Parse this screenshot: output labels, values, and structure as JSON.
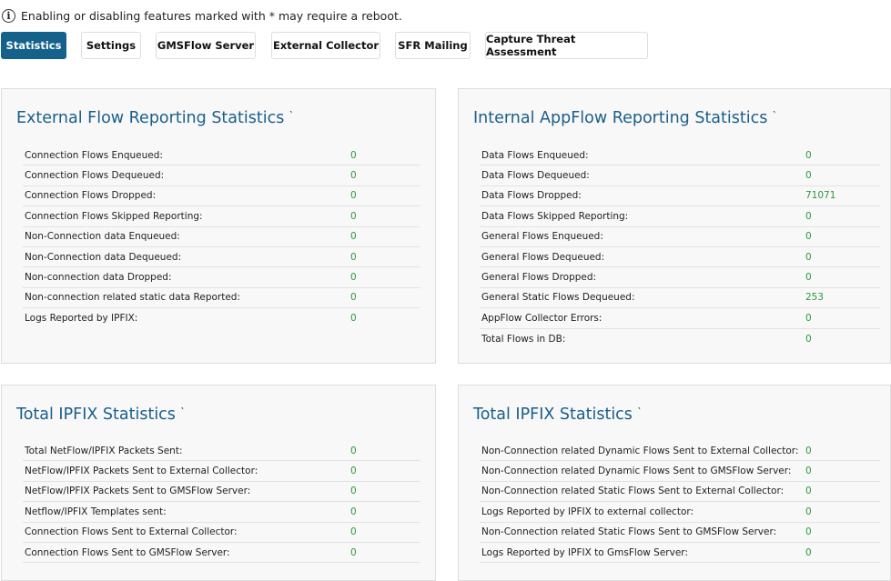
{
  "notice": {
    "icon": "info-icon",
    "text": "Enabling or disabling features marked with * may require a reboot."
  },
  "tabs": [
    {
      "label": "Statistics",
      "active": true
    },
    {
      "label": "Settings",
      "active": false
    },
    {
      "label": "GMSFlow Server",
      "active": false
    },
    {
      "label": "External Collector",
      "active": false
    },
    {
      "label": "SFR Mailing",
      "active": false
    },
    {
      "label": "Capture Threat Assessment",
      "active": false
    }
  ],
  "colors": {
    "accent": "#14618c",
    "title": "#1a5e8a",
    "value": "#2b9a3a"
  },
  "panels": [
    {
      "title": "External Flow Reporting Statistics",
      "rows": [
        {
          "label": "Connection Flows Enqueued:",
          "value": "0"
        },
        {
          "label": "Connection Flows Dequeued:",
          "value": "0"
        },
        {
          "label": "Connection Flows Dropped:",
          "value": "0"
        },
        {
          "label": "Connection Flows Skipped Reporting:",
          "value": "0"
        },
        {
          "label": "Non-Connection data Enqueued:",
          "value": "0"
        },
        {
          "label": "Non-Connection data Dequeued:",
          "value": "0"
        },
        {
          "label": "Non-connection data Dropped:",
          "value": "0"
        },
        {
          "label": "Non-connection related static data Reported:",
          "value": "0"
        },
        {
          "label": "Logs Reported by IPFIX:",
          "value": "0"
        }
      ]
    },
    {
      "title": "Internal AppFlow Reporting Statistics",
      "rows": [
        {
          "label": "Data Flows Enqueued:",
          "value": "0"
        },
        {
          "label": "Data Flows Dequeued:",
          "value": "0"
        },
        {
          "label": "Data Flows Dropped:",
          "value": "71071"
        },
        {
          "label": "Data Flows Skipped Reporting:",
          "value": "0"
        },
        {
          "label": "General Flows Enqueued:",
          "value": "0"
        },
        {
          "label": "General Flows Dequeued:",
          "value": "0"
        },
        {
          "label": "General Flows Dropped:",
          "value": "0"
        },
        {
          "label": "General Static Flows Dequeued:",
          "value": "253"
        },
        {
          "label": "AppFlow Collector Errors:",
          "value": "0"
        },
        {
          "label": "Total Flows in DB:",
          "value": "0"
        }
      ]
    },
    {
      "title": "Total IPFIX Statistics",
      "rows": [
        {
          "label": "Total NetFlow/IPFIX Packets Sent:",
          "value": "0"
        },
        {
          "label": "NetFlow/IPFIX Packets Sent to External Collector:",
          "value": "0"
        },
        {
          "label": "NetFlow/IPFIX Packets Sent to GMSFlow Server:",
          "value": "0"
        },
        {
          "label": "Netflow/IPFIX Templates sent:",
          "value": "0"
        },
        {
          "label": "Connection Flows Sent to External Collector:",
          "value": "0"
        },
        {
          "label": "Connection Flows Sent to GMSFlow Server:",
          "value": "0"
        }
      ]
    },
    {
      "title": "Total IPFIX Statistics",
      "rows": [
        {
          "label": "Non-Connection related Dynamic Flows Sent to External Collector:",
          "value": "0"
        },
        {
          "label": "Non-Connection related Dynamic Flows Sent to GMSFlow Server:",
          "value": "0"
        },
        {
          "label": "Non-Connection related Static Flows Sent to External Collector:",
          "value": "0"
        },
        {
          "label": "Logs Reported by IPFIX to external collector:",
          "value": "0"
        },
        {
          "label": "Non-Connection related Static Flows Sent to GMSFlow Server:",
          "value": "0"
        },
        {
          "label": "Logs Reported by IPFIX to GmsFlow Server:",
          "value": "0"
        }
      ]
    }
  ]
}
